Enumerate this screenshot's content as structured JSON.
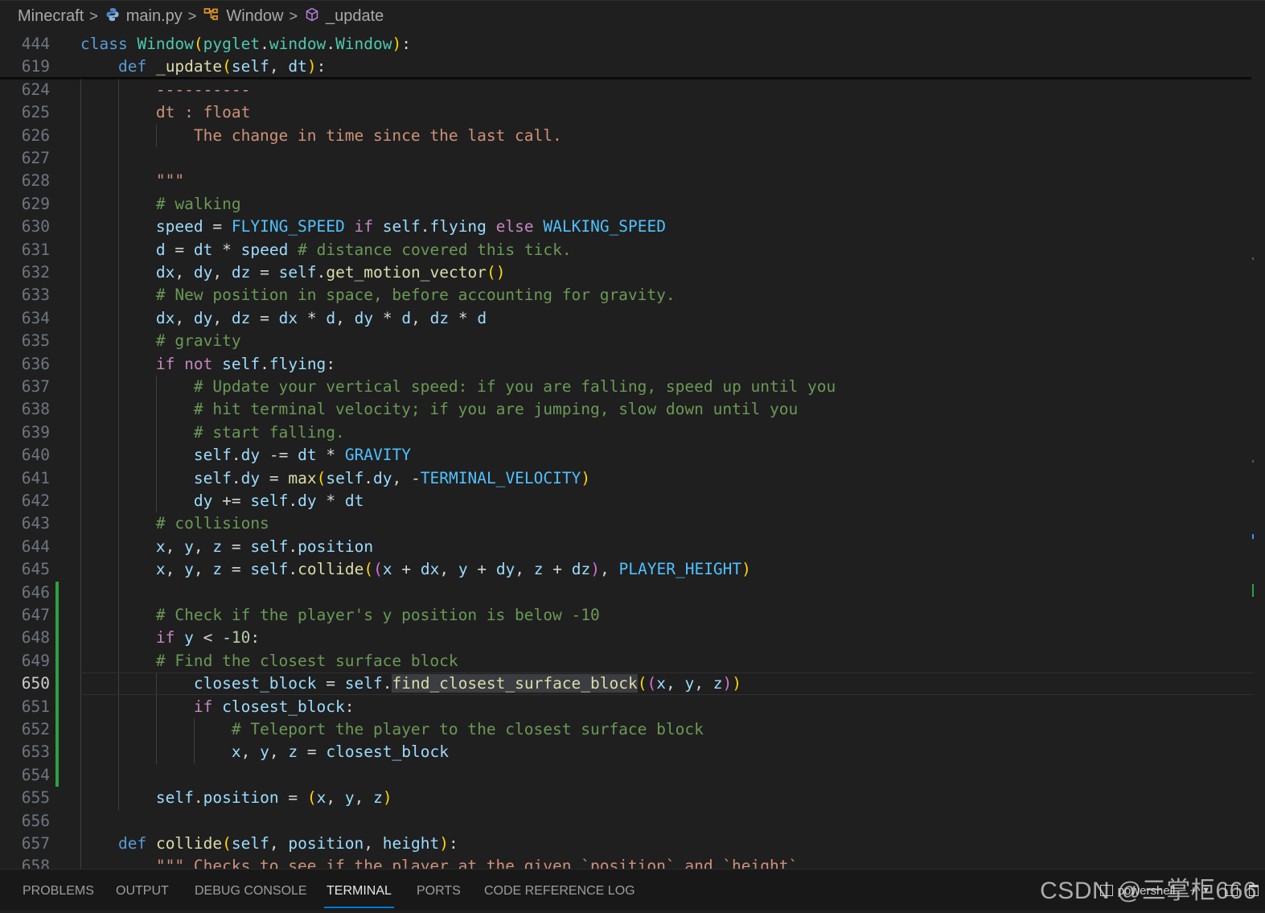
{
  "breadcrumb": {
    "items": [
      {
        "label": "Minecraft",
        "icon": "none"
      },
      {
        "label": "main.py",
        "icon": "python-icon"
      },
      {
        "label": "Window",
        "icon": "class-icon"
      },
      {
        "label": "_update",
        "icon": "method-icon"
      }
    ],
    "separator": ">"
  },
  "editor": {
    "language": "python",
    "active_line": "650",
    "sticky": [
      {
        "num": "444",
        "text": "class Window(pyglet.window.Window):"
      },
      {
        "num": "619",
        "text": "    def _update(self, dt):"
      }
    ],
    "lines": [
      {
        "num": "624",
        "text": "        ----------"
      },
      {
        "num": "625",
        "text": "        dt : float"
      },
      {
        "num": "626",
        "text": "            The change in time since the last call."
      },
      {
        "num": "627",
        "text": ""
      },
      {
        "num": "628",
        "text": "        \"\"\""
      },
      {
        "num": "629",
        "text": "        # walking"
      },
      {
        "num": "630",
        "text": "        speed = FLYING_SPEED if self.flying else WALKING_SPEED"
      },
      {
        "num": "631",
        "text": "        d = dt * speed # distance covered this tick."
      },
      {
        "num": "632",
        "text": "        dx, dy, dz = self.get_motion_vector()"
      },
      {
        "num": "633",
        "text": "        # New position in space, before accounting for gravity."
      },
      {
        "num": "634",
        "text": "        dx, dy, dz = dx * d, dy * d, dz * d"
      },
      {
        "num": "635",
        "text": "        # gravity"
      },
      {
        "num": "636",
        "text": "        if not self.flying:"
      },
      {
        "num": "637",
        "text": "            # Update your vertical speed: if you are falling, speed up until you"
      },
      {
        "num": "638",
        "text": "            # hit terminal velocity; if you are jumping, slow down until you"
      },
      {
        "num": "639",
        "text": "            # start falling."
      },
      {
        "num": "640",
        "text": "            self.dy -= dt * GRAVITY"
      },
      {
        "num": "641",
        "text": "            self.dy = max(self.dy, -TERMINAL_VELOCITY)"
      },
      {
        "num": "642",
        "text": "            dy += self.dy * dt"
      },
      {
        "num": "643",
        "text": "        # collisions"
      },
      {
        "num": "644",
        "text": "        x, y, z = self.position"
      },
      {
        "num": "645",
        "text": "        x, y, z = self.collide((x + dx, y + dy, z + dz), PLAYER_HEIGHT)"
      },
      {
        "num": "646",
        "text": ""
      },
      {
        "num": "647",
        "text": "        # Check if the player's y position is below -10"
      },
      {
        "num": "648",
        "text": "        if y < -10:"
      },
      {
        "num": "649",
        "text": "        # Find the closest surface block"
      },
      {
        "num": "650",
        "text": "            closest_block = self.find_closest_surface_block((x, y, z))"
      },
      {
        "num": "651",
        "text": "            if closest_block:"
      },
      {
        "num": "652",
        "text": "                # Teleport the player to the closest surface block"
      },
      {
        "num": "653",
        "text": "                x, y, z = closest_block"
      },
      {
        "num": "654",
        "text": ""
      },
      {
        "num": "655",
        "text": "        self.position = (x, y, z)"
      },
      {
        "num": "656",
        "text": ""
      },
      {
        "num": "657",
        "text": "    def collide(self, position, height):"
      },
      {
        "num": "658",
        "text": "        \"\"\" Checks to see if the player at the given `position` and `height`"
      }
    ]
  },
  "panel": {
    "tabs": [
      "PROBLEMS",
      "OUTPUT",
      "DEBUG CONSOLE",
      "TERMINAL",
      "PORTS",
      "CODE REFERENCE LOG"
    ],
    "active_tab": "TERMINAL",
    "terminal_name": "powershell"
  },
  "watermark": "CSDN @三掌柜666",
  "colors": {
    "background": "#1f1f1f",
    "keyword": "#569cd6",
    "control": "#c586c0",
    "class_name": "#4ec9b0",
    "function": "#dcdcaa",
    "variable": "#9cdcfe",
    "constant": "#4fc1ff",
    "string": "#ce9178",
    "comment": "#6a9955",
    "number": "#b5cea8",
    "git_modified": "#2ea043",
    "tab_accent": "#0078d4"
  }
}
